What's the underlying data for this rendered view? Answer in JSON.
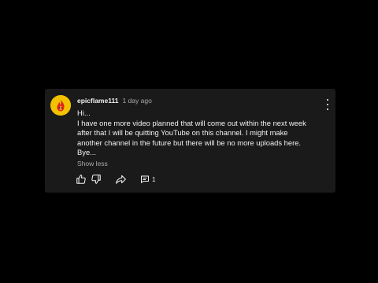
{
  "comment": {
    "username": "epicflame111",
    "timestamp": "1 day ago",
    "lines": [
      "Hi...",
      "I have one more video planned that will come out within the next week",
      "after that I will be quitting YouTube on this channel. I might make",
      "another channel in the future but there will be no more uploads here.",
      "Bye..."
    ],
    "show_less_label": "Show less",
    "reply_count": "1"
  },
  "colors": {
    "background": "#000000",
    "card": "#1a1a1a",
    "text": "#f1f1f1",
    "muted": "#aaaaaa",
    "avatar_bg": "#f2c200",
    "flame": "#e0241b"
  },
  "icons": {
    "avatar": "flame-avatar-icon",
    "menu": "more-vertical-icon",
    "like": "thumbs-up-icon",
    "dislike": "thumbs-down-icon",
    "share": "share-icon",
    "replies": "comment-icon"
  }
}
